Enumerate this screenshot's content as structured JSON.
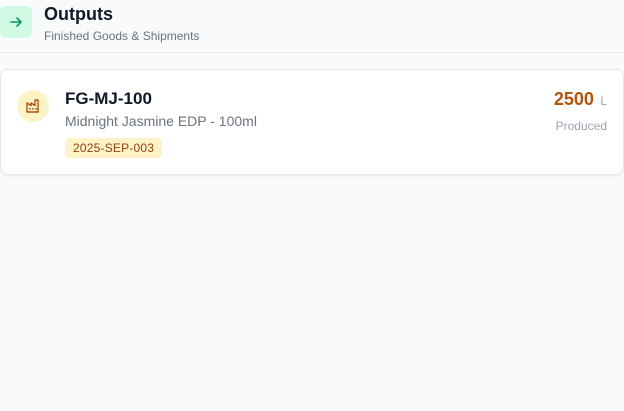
{
  "header": {
    "title": "Outputs",
    "subtitle": "Finished Goods & Shipments",
    "icon": "arrow-right-icon"
  },
  "outputs": [
    {
      "sku": "FG-MJ-100",
      "name": "Midnight Jasmine EDP - 100ml",
      "batch": "2025-SEP-003",
      "quantity": "2500",
      "unit": "L",
      "status": "Produced",
      "icon": "factory-icon"
    }
  ],
  "colors": {
    "accent_green_bg": "#d1fae5",
    "accent_green": "#059669",
    "amber_bg": "#fef3c7",
    "amber_text": "#92400e",
    "quantity": "#b45309"
  }
}
